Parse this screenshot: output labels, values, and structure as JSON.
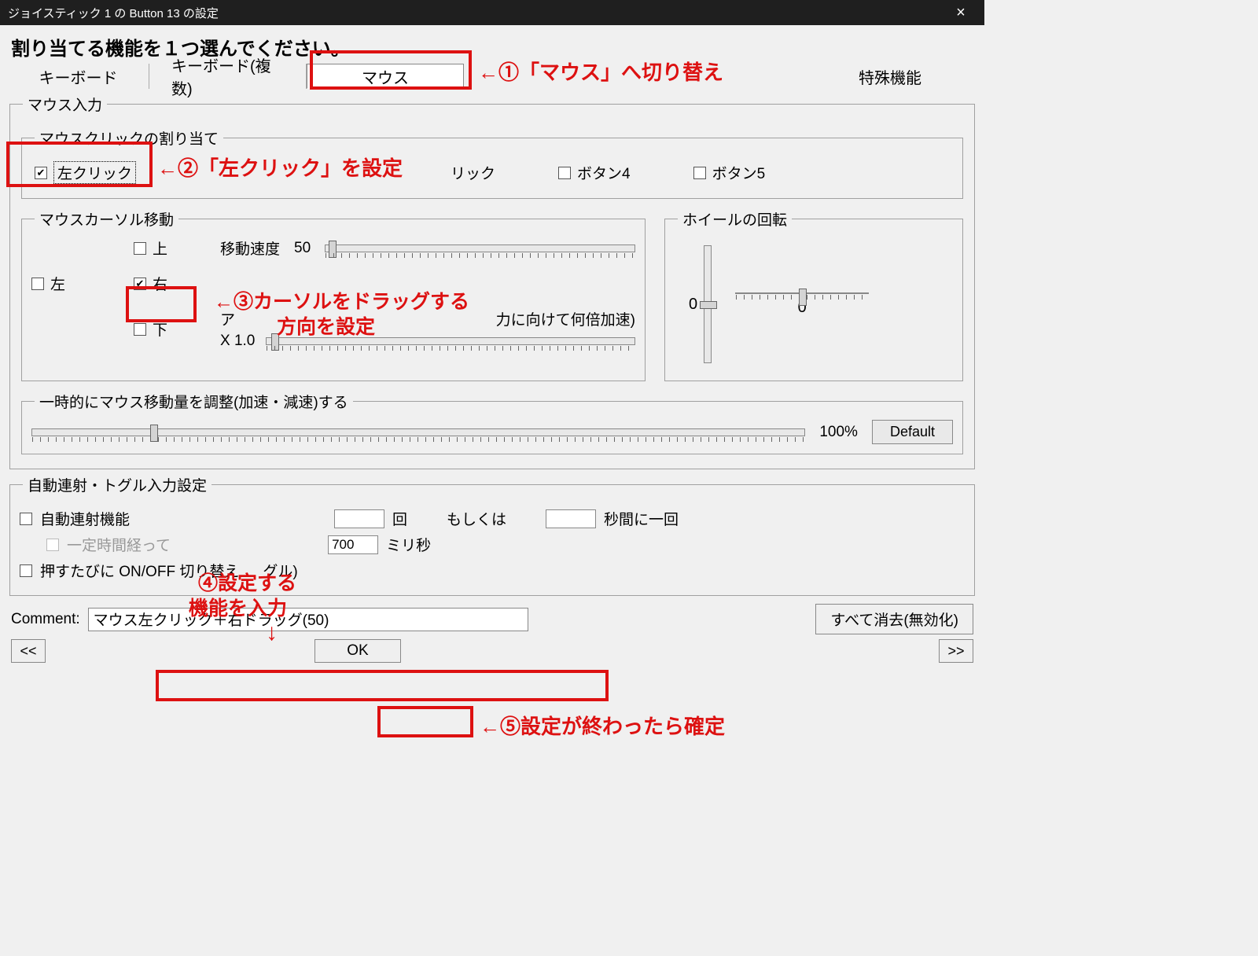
{
  "window": {
    "title": "ジョイスティック 1 の Button 13 の設定",
    "close": "×"
  },
  "heading": "割り当てる機能を１つ選んでください。",
  "tabs": {
    "keyboard": "キーボード",
    "keyboard_multi": "キーボード(複数)",
    "mouse": "マウス",
    "special": "特殊機能"
  },
  "mouse_input": {
    "legend": "マウス入力",
    "click_assign": {
      "legend": "マウスクリックの割り当て",
      "left": "左クリック",
      "right_partial": "リック",
      "button4": "ボタン4",
      "button5": "ボタン5"
    },
    "cursor": {
      "legend": "マウスカーソル移動",
      "up": "上",
      "down": "下",
      "left": "左",
      "right": "右",
      "speed_label": "移動速度",
      "speed_value": "50",
      "analog_prefix": "ア",
      "analog_suffix": "力に向けて何倍加速)",
      "x_label": "X 1.0"
    },
    "wheel": {
      "legend": "ホイールの回転",
      "v_value": "0",
      "h_value": "0"
    },
    "temp_adjust": {
      "legend": "一時的にマウス移動量を調整(加速・減速)する",
      "percent": "100%",
      "default": "Default"
    }
  },
  "auto": {
    "legend": "自動連射・トグル入力設定",
    "autofire": "自動連射機能",
    "unit_kai": "回",
    "or": "もしくは",
    "per_sec": "秒間に一回",
    "after_time_prefix": "一定時間経って",
    "ms_value": "700",
    "ms_unit": "ミリ秒",
    "toggle_label": "押すたびに ON/OFF 切り替え",
    "toggle_suffix": "グル)"
  },
  "footer": {
    "comment_label": "Comment:",
    "comment_value": "マウス左クリック＋右ドラッグ(50)",
    "clear": "すべて消去(無効化)",
    "prev": "<<",
    "ok": "OK",
    "next": ">>"
  },
  "annotations": {
    "a1": "←①「マウス」へ切り替え",
    "a2": "←②「左クリック」を設定",
    "a3a": "←③カーソルをドラッグする",
    "a3b": "方向を設定",
    "a4a": "④設定する",
    "a4b": "機能を入力",
    "arrow": "↓",
    "a5": "←⑤設定が終わったら確定"
  }
}
